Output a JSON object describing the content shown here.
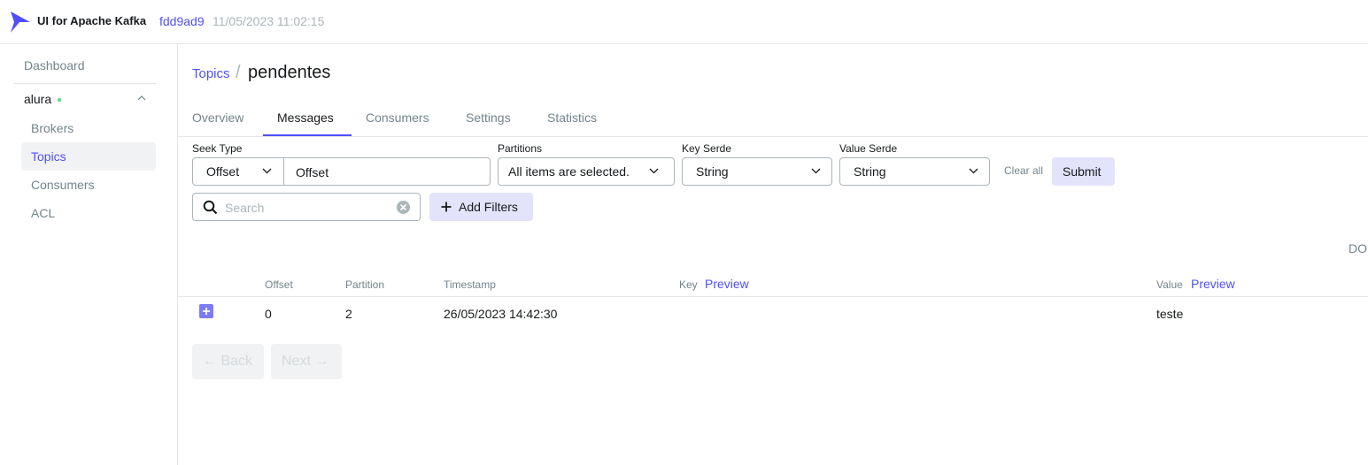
{
  "app": {
    "title": "UI for Apache Kafka",
    "version_hash": "fdd9ad9",
    "version_date": "11/05/2023 11:02:15",
    "logo_icon": "kafka-ui-logo-icon"
  },
  "sidebar": {
    "dashboard": "Dashboard",
    "cluster": "alura",
    "cluster_status_color": "#5cd685",
    "items": [
      {
        "label": "Brokers",
        "active": false
      },
      {
        "label": "Topics",
        "active": true
      },
      {
        "label": "Consumers",
        "active": false
      },
      {
        "label": "ACL",
        "active": false
      }
    ]
  },
  "breadcrumb": {
    "parent": "Topics",
    "separator": "/",
    "current": "pendentes"
  },
  "tabs": [
    {
      "label": "Overview",
      "active": false
    },
    {
      "label": "Messages",
      "active": true
    },
    {
      "label": "Consumers",
      "active": false
    },
    {
      "label": "Settings",
      "active": false
    },
    {
      "label": "Statistics",
      "active": false
    }
  ],
  "filters": {
    "seek_type_label": "Seek Type",
    "seek_type_value": "Offset",
    "seek_input_value": "Offset",
    "partitions_label": "Partitions",
    "partitions_value": "All items are selected.",
    "key_serde_label": "Key Serde",
    "key_serde_value": "String",
    "value_serde_label": "Value Serde",
    "value_serde_value": "String",
    "clear_all": "Clear all",
    "submit": "Submit",
    "search_placeholder": "Search",
    "add_filters": "Add Filters"
  },
  "download_label": "DO",
  "table": {
    "headers": {
      "offset": "Offset",
      "partition": "Partition",
      "timestamp": "Timestamp",
      "key": "Key",
      "key_preview": "Preview",
      "value": "Value",
      "value_preview": "Preview"
    },
    "rows": [
      {
        "offset": "0",
        "partition": "2",
        "timestamp": "26/05/2023 14:42:30",
        "key": "",
        "value": "teste"
      }
    ]
  },
  "pagination": {
    "back": "← Back",
    "next": "Next →"
  },
  "colors": {
    "accent": "#4f4fff",
    "accent_light": "#e3e3fc",
    "muted_text": "#73848c"
  }
}
